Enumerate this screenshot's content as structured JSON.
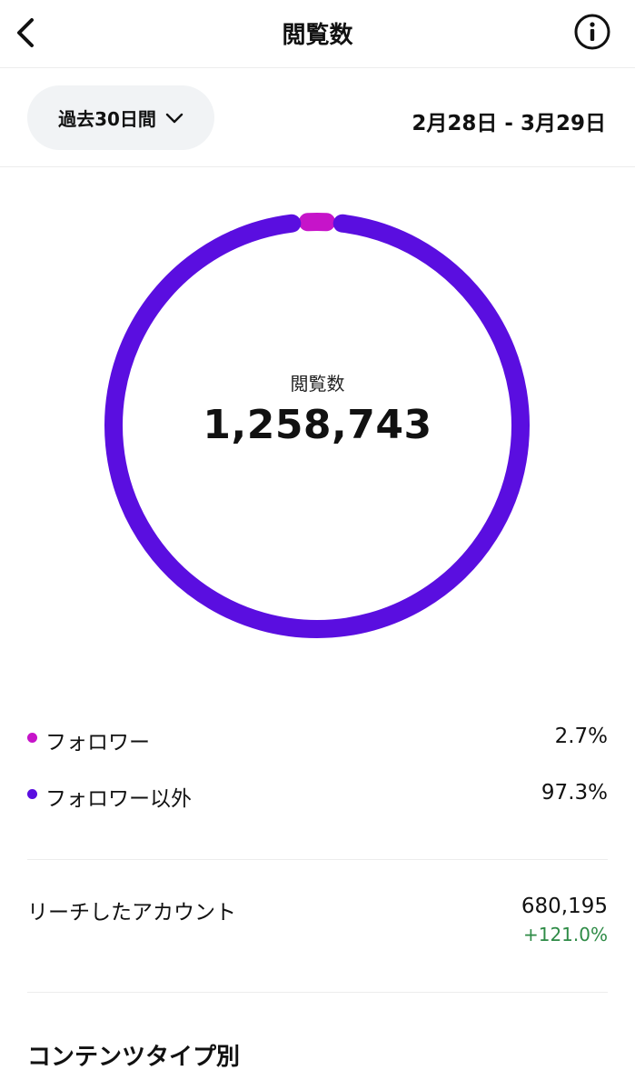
{
  "header": {
    "title": "閲覧数",
    "back_icon": "chevron-left-icon",
    "info_icon": "info-circle-icon"
  },
  "filter": {
    "period_label": "過去30日間",
    "dropdown_icon": "chevron-down-icon",
    "date_range": "2月28日 - 3月29日"
  },
  "summary": {
    "label": "閲覧数",
    "total": "1,258,743"
  },
  "colors": {
    "followers": "#c614c9",
    "non_followers": "#5a0ee0",
    "positive_change": "#2e8b46"
  },
  "breakdown": [
    {
      "label": "フォロワー",
      "value": "2.7%",
      "percent": 2.7,
      "color": "#c614c9"
    },
    {
      "label": "フォロワー以外",
      "value": "97.3%",
      "percent": 97.3,
      "color": "#5a0ee0"
    }
  ],
  "reach": {
    "label": "リーチしたアカウント",
    "value": "680,195",
    "change": "+121.0%"
  },
  "content_type": {
    "title": "コンテンツタイプ別"
  }
}
